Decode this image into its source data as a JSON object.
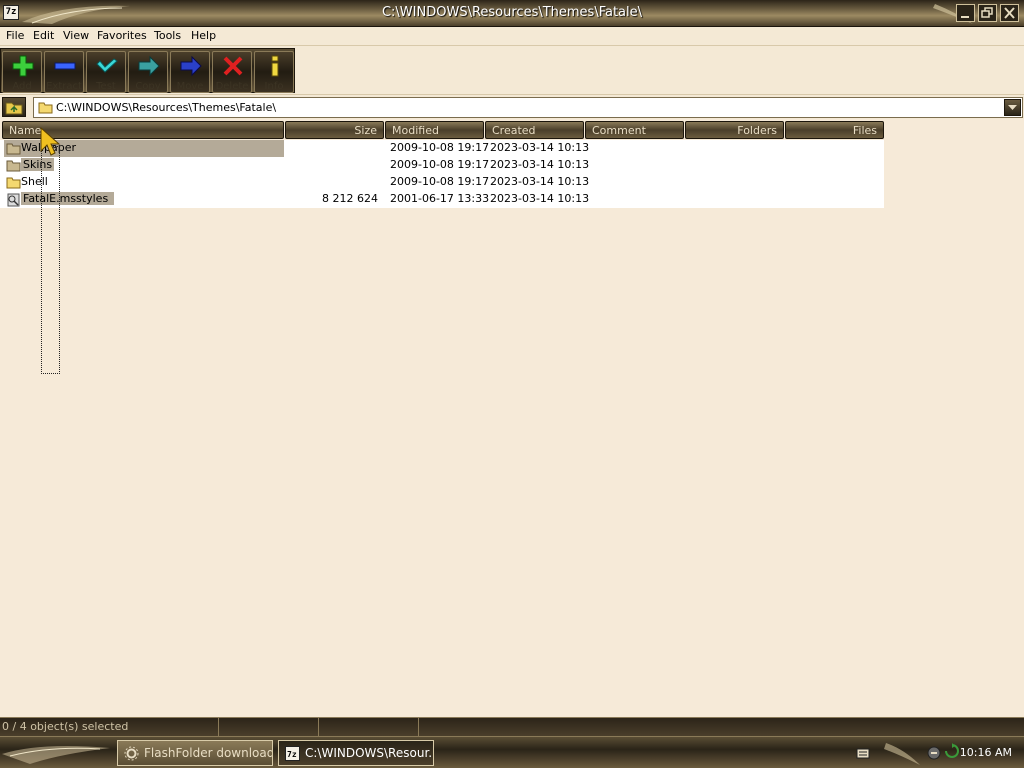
{
  "window": {
    "title": "C:\\WINDOWS\\Resources\\Themes\\Fatale\\",
    "app_icon_text": "7z",
    "buttons": [
      "minimize-icon",
      "restore-icon",
      "close-icon"
    ]
  },
  "menu": [
    "File",
    "Edit",
    "View",
    "Favorites",
    "Tools",
    "Help"
  ],
  "toolbar": {
    "buttons": [
      {
        "label": "Add",
        "icon": "plus-icon",
        "color": "#3ccf3c"
      },
      {
        "label": "Extract",
        "icon": "minus-icon",
        "color": "#3a64ff"
      },
      {
        "label": "Test",
        "icon": "check-icon",
        "color": "#3ad8d8"
      },
      {
        "label": "Copy",
        "icon": "copy-arrow-icon",
        "color": "#3aa0a0"
      },
      {
        "label": "Move",
        "icon": "move-arrow-icon",
        "color": "#2a40c8"
      },
      {
        "label": "Delete",
        "icon": "delete-x-icon",
        "color": "#e02020"
      },
      {
        "label": "Info",
        "icon": "info-icon",
        "color": "#f0d840"
      }
    ]
  },
  "address": {
    "path": "C:\\WINDOWS\\Resources\\Themes\\Fatale\\"
  },
  "columns": [
    "Name",
    "Size",
    "Modified",
    "Created",
    "Comment",
    "Folders",
    "Files"
  ],
  "files": [
    {
      "name": "Wallpaper",
      "type": "folder",
      "size": "",
      "modified": "2009-10-08 19:17",
      "created": "2023-03-14 10:13",
      "highlight": "name"
    },
    {
      "name": "Skins",
      "type": "folder",
      "size": "",
      "modified": "2009-10-08 19:17",
      "created": "2023-03-14 10:13",
      "highlight": "label"
    },
    {
      "name": "Shell",
      "type": "folder",
      "size": "",
      "modified": "2009-10-08 19:17",
      "created": "2023-03-14 10:13",
      "highlight": "none"
    },
    {
      "name": "FatalE.msstyles",
      "type": "file",
      "size": "8 212 624",
      "modified": "2001-06-17 13:33",
      "created": "2023-03-14 10:13",
      "highlight": "label"
    }
  ],
  "status": {
    "selected": "0 / 4 object(s) selected"
  },
  "taskbar": {
    "tasks": [
      {
        "label": "FlashFolder download...",
        "active": false
      },
      {
        "label": "C:\\WINDOWS\\Resour...",
        "active": true
      }
    ],
    "clock": "10:16 AM"
  },
  "colors": {
    "accent": "#4a3e2a",
    "background": "#f6ead8",
    "highlight": "#b4aa98"
  }
}
